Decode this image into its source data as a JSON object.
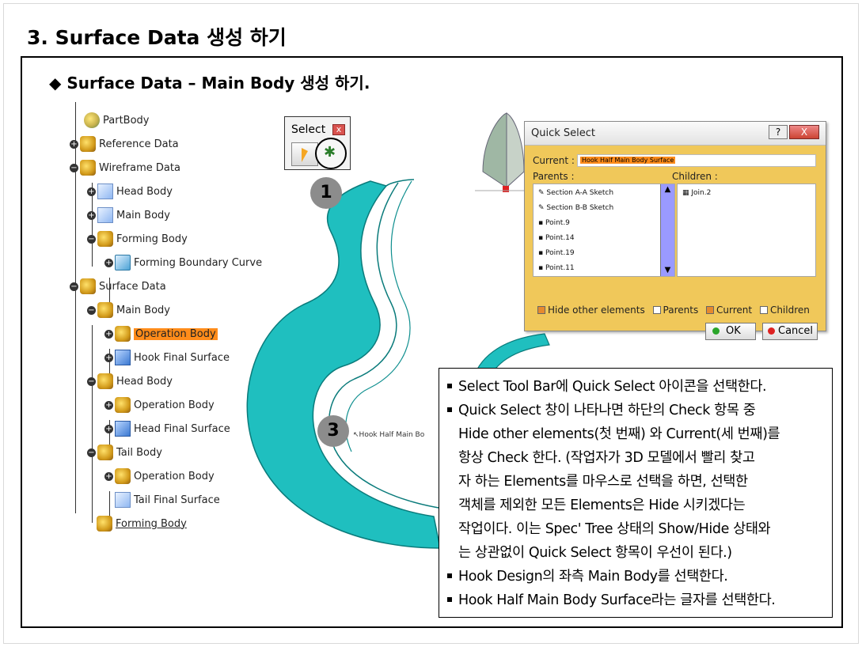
{
  "page": {
    "title": "3. Surface Data 생성 하기",
    "subtitle": "◆ Surface Data – Main Body 생성 하기."
  },
  "tree": {
    "items": [
      {
        "label": "PartBody",
        "icon": "partbody-icon"
      },
      {
        "label": "Reference Data",
        "icon": "body-icon"
      },
      {
        "label": "Wireframe Data",
        "icon": "body-icon"
      },
      {
        "label": "Head Body",
        "icon": "sketch-body-icon"
      },
      {
        "label": "Main Body",
        "icon": "sketch-body-icon"
      },
      {
        "label": "Forming Body",
        "icon": "body-icon"
      },
      {
        "label": "Forming Boundary Curve",
        "icon": "boundary-icon"
      },
      {
        "label": "Surface Data",
        "icon": "body-icon"
      },
      {
        "label": "Main Body",
        "icon": "body-icon"
      },
      {
        "label": "Operation Body",
        "icon": "body-icon",
        "highlighted": true
      },
      {
        "label": "Hook Final Surface",
        "icon": "surface-icon"
      },
      {
        "label": "Head Body",
        "icon": "body-icon"
      },
      {
        "label": "Operation Body",
        "icon": "body-icon"
      },
      {
        "label": "Head Final Surface",
        "icon": "surface-icon"
      },
      {
        "label": "Tail Body",
        "icon": "body-icon"
      },
      {
        "label": "Operation Body",
        "icon": "body-icon"
      },
      {
        "label": "Tail Final Surface",
        "icon": "curve-icon"
      },
      {
        "label": "Forming Body",
        "icon": "body-icon"
      }
    ]
  },
  "select_toolbar": {
    "title": "Select",
    "close": "x"
  },
  "badges": {
    "one": "1",
    "two": "2",
    "three": "3"
  },
  "model_label": "Hook Half Main Bo",
  "quick_select": {
    "title": "Quick Select",
    "help": "?",
    "close": "X",
    "current_label": "Current :",
    "current_value": "Hook Half Main Body Surface",
    "parents_label": "Parents :",
    "children_label": "Children :",
    "parents": [
      "Section A-A Sketch",
      "Section B-B Sketch",
      "Point.9",
      "Point.14",
      "Point.19",
      "Point.11"
    ],
    "children": [
      "Join.2"
    ],
    "options": {
      "hide_other": "Hide other elements",
      "parents": "Parents",
      "current": "Current",
      "children": "Children"
    },
    "ok": "OK",
    "cancel": "Cancel"
  },
  "notes": {
    "line1": "Select Tool Bar에 Quick Select 아이콘을 선택한다.",
    "line2": "Quick Select 창이 나타나면 하단의 Check 항목 중",
    "line2b": "Hide other elements(첫 번째) 와 Current(세 번째)를",
    "line2c": "항상 Check 한다. (작업자가 3D 모델에서 빨리 찾고",
    "line2d": "자 하는 Elements를 마우스로 선택을 하면, 선택한",
    "line2e": "객체를 제외한 모든 Elements은 Hide 시키겠다는",
    "line2f": "작업이다. 이는 Spec' Tree 상태의 Show/Hide 상태와",
    "line2g": "는 상관없이 Quick Select 항목이 우선이 된다.)",
    "line3": "Hook Design의 좌측 Main Body를 선택한다.",
    "line4": "Hook Half Main Body Surface라는 글자를 선택한다."
  },
  "colors": {
    "model": "#1fbfbf",
    "highlight": "#ff8c1a",
    "dialog": "#f0c85a"
  }
}
